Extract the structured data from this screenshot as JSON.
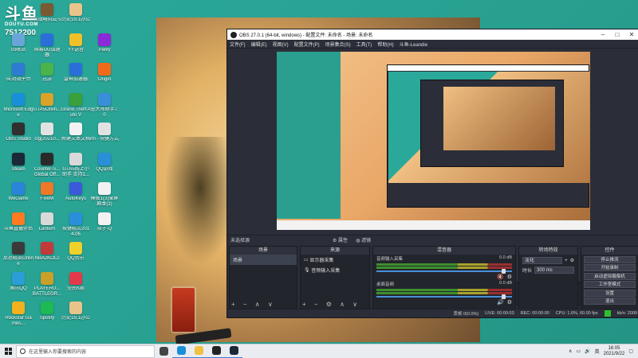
{
  "watermark": {
    "logo": "斗鱼",
    "sub": "DOUYU.COM",
    "room": "7512200"
  },
  "desktop_icons": [
    {
      "label": "回收站",
      "color": "#6aa5d9",
      "col": 0,
      "row": 1
    },
    {
      "label": "5E对战平台",
      "color": "#2e7bd1",
      "col": 0,
      "row": 2
    },
    {
      "label": "Microsoft Edge",
      "color": "#1a8fd9",
      "col": 0,
      "row": 3
    },
    {
      "label": "OBS Studio",
      "color": "#303030",
      "col": 0,
      "row": 4
    },
    {
      "label": "Steam",
      "color": "#1b2838",
      "col": 0,
      "row": 5
    },
    {
      "label": "WeGame",
      "color": "#2a84d9",
      "col": 0,
      "row": 6
    },
    {
      "label": "斗鱼直播伴侣",
      "color": "#ff7a20",
      "col": 0,
      "row": 7
    },
    {
      "label": "反恐精英Online",
      "color": "#3a3a3a",
      "col": 0,
      "row": 8
    },
    {
      "label": "腾讯QQ",
      "color": "#2b9ed9",
      "col": 0,
      "row": 9
    },
    {
      "label": "Rockstar Games...",
      "color": "#f1b21d",
      "col": 0,
      "row": 10
    },
    {
      "label": "《战略风云 5",
      "color": "#7a5a32",
      "col": 1,
      "row": 0
    },
    {
      "label": "网易UU加速器",
      "color": "#2a6fd9",
      "col": 1,
      "row": 1
    },
    {
      "label": "迅游",
      "color": "#4ab34a",
      "col": 1,
      "row": 2
    },
    {
      "label": "GTA5Onlin...",
      "color": "#d9a32a",
      "col": 1,
      "row": 3
    },
    {
      "label": "clg(20210...",
      "color": "#e2e2e2",
      "col": 1,
      "row": 4
    },
    {
      "label": "Counter-S... Global Off...",
      "color": "#2a2a2a",
      "col": 1,
      "row": 5
    },
    {
      "label": "FiveM",
      "color": "#f07828",
      "col": 1,
      "row": 6
    },
    {
      "label": "Lantern",
      "color": "#d9d9d9",
      "col": 1,
      "row": 7
    },
    {
      "label": "NBA2KOL2",
      "color": "#c23a3a",
      "col": 1,
      "row": 8
    },
    {
      "label": "PLAYERU... BATTLEGR...",
      "color": "#c9a02a",
      "col": 1,
      "row": 9
    },
    {
      "label": "Spotify",
      "color": "#1db954",
      "col": 1,
      "row": 10
    },
    {
      "label": "历史19.1办公",
      "color": "#e9c48a",
      "col": 2,
      "row": 0
    },
    {
      "label": "YY语音",
      "color": "#f0c02a",
      "col": 2,
      "row": 1
    },
    {
      "label": "雷神加速器",
      "color": "#2a6fd9",
      "col": 2,
      "row": 2
    },
    {
      "label": "Grand Theft Auto V",
      "color": "#3aa03a",
      "col": 2,
      "row": 3
    },
    {
      "label": "新建文本文档",
      "color": "#f2f2f2",
      "col": 2,
      "row": 4
    },
    {
      "label": "GTA5线上小助手 支持1...",
      "color": "#d9d9d9",
      "col": 2,
      "row": 5
    },
    {
      "label": "AutoKeys",
      "color": "#3a5ad9",
      "col": 2,
      "row": 6
    },
    {
      "label": "按键精灵2014.06",
      "color": "#2a8fd9",
      "col": 2,
      "row": 7
    },
    {
      "label": "QQ音乐",
      "color": "#f0d02a",
      "col": 2,
      "row": 8
    },
    {
      "label": "全民K歌",
      "color": "#e23a4a",
      "col": 2,
      "row": 9
    },
    {
      "label": "历史19.1办公",
      "color": "#e9c48a",
      "col": 2,
      "row": 10
    },
    {
      "label": "Parily",
      "color": "#8a2ad9",
      "col": 3,
      "row": 1
    },
    {
      "label": "Origin",
      "color": "#f06a1a",
      "col": 3,
      "row": 2
    },
    {
      "label": "鲁大师助手7.0",
      "color": "#3a8fd9",
      "col": 3,
      "row": 3
    },
    {
      "label": "rm - 快捷方式",
      "color": "#e2e2e2",
      "col": 3,
      "row": 4
    },
    {
      "label": "QQ游戏",
      "color": "#2a8fd9",
      "col": 3,
      "row": 5
    },
    {
      "label": "模板1(3)录屏剧本(1)",
      "color": "#f2f2f2",
      "col": 3,
      "row": 6
    },
    {
      "label": "孩子-Q",
      "color": "#f2f2f2",
      "col": 3,
      "row": 7
    }
  ],
  "obs": {
    "title": "OBS 27.0.1 (64-bit, windows) - 配置文件: 未命名 - 场景: 未命名",
    "menus": [
      "文件(F)",
      "编辑(E)",
      "视图(V)",
      "配置文件(P)",
      "场景集合(S)",
      "工具(T)",
      "帮助(H)",
      "斗鱼-Leandie"
    ],
    "source_bar": {
      "label": "未选择源",
      "props": "属性",
      "filters": "滤镜"
    },
    "scenes": {
      "title": "场景",
      "items": [
        "场景"
      ]
    },
    "sources": {
      "title": "来源",
      "items": [
        "显示器采集",
        "音频输入采集"
      ]
    },
    "mixer": {
      "title": "混音器",
      "channels": [
        {
          "name": "音频输入采集",
          "db": "0.0 dB"
        },
        {
          "name": "桌面音频",
          "db": "0.0 dB"
        }
      ]
    },
    "transitions": {
      "title": "转场特效",
      "type": "淡化",
      "duration_label": "时长",
      "duration": "300 ms"
    },
    "controls": {
      "title": "控件",
      "buttons": [
        "停止推流",
        "开始录制",
        "启动虚拟摄像机",
        "工作室模式",
        "设置",
        "退出"
      ]
    },
    "status": {
      "dropped": "丢帧 0(0.0%)",
      "live": "LIVE: 00:00:03",
      "rec": "REC: 00:00:00",
      "cpu": "CPU: 1.6%, 60.00 fps",
      "bitrate": "kb/s: 2000"
    }
  },
  "taskbar": {
    "search_placeholder": "在这里输入你要搜索的内容",
    "apps": [
      {
        "name": "task-view",
        "color": "#444"
      },
      {
        "name": "edge",
        "color": "#1a8fd9"
      },
      {
        "name": "explorer",
        "color": "#f0c040"
      },
      {
        "name": "obs",
        "color": "#222"
      },
      {
        "name": "steam",
        "color": "#1b2838"
      }
    ],
    "time": "16:05",
    "date": "2021/9/22",
    "ime": "英"
  }
}
